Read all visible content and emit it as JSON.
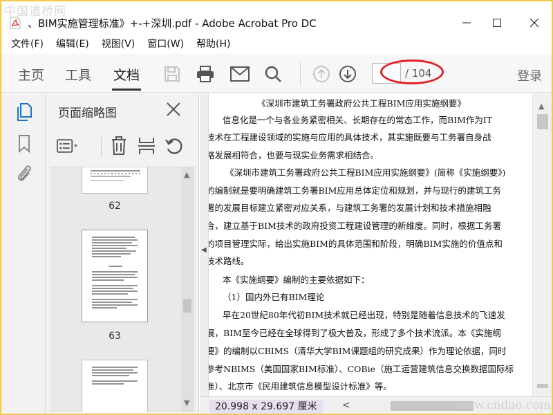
{
  "watermark": {
    "top": "中国道桥网",
    "bottom": "www.cndao.com"
  },
  "window": {
    "title": "、BIM实施管理标准》+-+深圳.pdf - Adobe Acrobat Pro DC"
  },
  "menu": {
    "items": [
      "文件(F)",
      "编辑(E)",
      "视图(V)",
      "窗口(W)",
      "帮助(H)"
    ]
  },
  "toolbar": {
    "tabs": {
      "home": "主页",
      "tools": "工具",
      "document": "文档"
    },
    "page_current": "",
    "page_total": "/ 104",
    "login": "登录"
  },
  "panel": {
    "title": "页面缩略图",
    "thumbnails": [
      {
        "page": "62"
      },
      {
        "page": "63"
      }
    ]
  },
  "document": {
    "lines": [
      "《深圳市建筑工务署政府公共工程BIM应用实施纲要》",
      "信息化是一个与各业务紧密相关、长期存在的常态工作，而BIM作为IT",
      "技术在工程建设领域的实施与应用的具体技术，其实施既要与工务署自身战",
      "略发展相符合，也要与现实业务需求相结合。",
      "《深圳市建筑工务署政府公共工程BIM应用实施纲要》(简称《实施纲要》)",
      "的编制就是要明确建筑工务署BIM应用总体定位和规划，并与现行的建筑工务",
      "署的发展目标建立紧密对应关系，与建筑工务署的发展计划和技术措施相融",
      "合，建立基于BIM技术的政府投资工程建设管理的新维度。同时，根据工务署",
      "的项目管理实际，给出实施BIM的具体范围和阶段，明确BIM实施的价值点和",
      "技术路线。",
      "本《实施纲要》编制的主要依据如下：",
      "（1）国内外已有BIM理论",
      "早在20世纪80年代初BIM技术就已经出现，特别是随着信息技术的飞速发",
      "展，BIM至今已经在全球得到了极大普及，形成了多个技术流派。本《实施纲",
      "要》的编制以CBIMS（清华大学BIM课题组的研究成果）作为理论依据，同时",
      "参考NBIMS（美国国家BIM标准）、COBie（施工运营建筑信息交换数据国际标",
      "准）、北京市《民用建筑信息模型设计标准》等。"
    ]
  },
  "status": {
    "page_size": "20.998 x 29.697 厘米"
  },
  "colors": {
    "accent": "#1a73c8",
    "annotation": "#e02020",
    "frame": "#f2c94c"
  }
}
